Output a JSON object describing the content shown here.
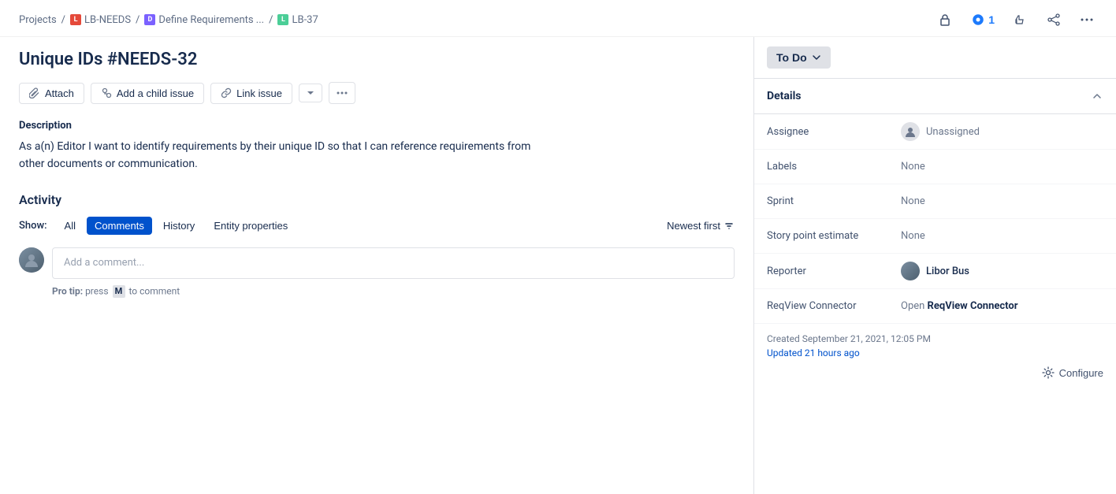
{
  "breadcrumb": {
    "projects": "Projects",
    "sep1": "/",
    "lb_needs": "LB-NEEDS",
    "sep2": "/",
    "define_req": "Define Requirements ...",
    "sep3": "/",
    "lb37": "LB-37"
  },
  "top_actions": {
    "lock_icon": "🔒",
    "watch_icon": "👁",
    "watch_count": "1",
    "like_icon": "👍",
    "share_icon": "↗",
    "more_icon": "···"
  },
  "issue": {
    "title": "Unique IDs #NEEDS-32"
  },
  "toolbar": {
    "attach_label": "Attach",
    "add_child_label": "Add a child issue",
    "link_issue_label": "Link issue"
  },
  "description": {
    "heading": "Description",
    "text_line1": "As a(n)  Editor I want to  identify requirements by their unique ID so that  I can reference requirements from",
    "text_line2": "other documents or communication."
  },
  "activity": {
    "heading": "Activity",
    "show_label": "Show:",
    "tab_all": "All",
    "tab_comments": "Comments",
    "tab_history": "History",
    "tab_entity": "Entity properties",
    "newest_first": "Newest first",
    "comment_placeholder": "Add a comment...",
    "protip_text1": "Pro tip:",
    "protip_press": "press",
    "protip_key": "M",
    "protip_text2": "to comment"
  },
  "status": {
    "label": "To Do",
    "chevron": "▾"
  },
  "details": {
    "heading": "Details",
    "chevron": "∧",
    "assignee_label": "Assignee",
    "assignee_value": "Unassigned",
    "labels_label": "Labels",
    "labels_value": "None",
    "sprint_label": "Sprint",
    "sprint_value": "None",
    "story_point_label": "Story point estimate",
    "story_point_value": "None",
    "reporter_label": "Reporter",
    "reporter_value": "Libor Bus",
    "reqview_label": "ReqView Connector",
    "reqview_text": "Open ",
    "reqview_bold": "ReqView Connector"
  },
  "footer": {
    "created_label": "Created September 21, 2021, 12:05 PM",
    "updated_label": "Updated 21 hours ago",
    "configure_label": "Configure"
  }
}
